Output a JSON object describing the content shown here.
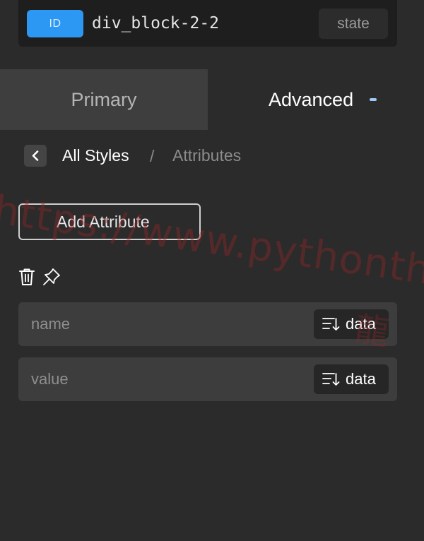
{
  "selector": {
    "badge": "ID",
    "name": "div_block-2-2",
    "state_label": "state"
  },
  "tabs": [
    {
      "label": "Primary",
      "active": false
    },
    {
      "label": "Advanced",
      "active": true
    }
  ],
  "breadcrumb": {
    "current": "All Styles",
    "separator": "/",
    "last": "Attributes"
  },
  "add_attribute_label": "Add Attribute",
  "fields": [
    {
      "placeholder": "name",
      "data_label": "data"
    },
    {
      "placeholder": "value",
      "data_label": "data"
    }
  ],
  "icons": {
    "back": "chevron-left-icon",
    "delete": "trash-icon",
    "pin": "pin-icon",
    "data": "sort-down-icon"
  },
  "watermark": {
    "text": "https://www.pythonthre",
    "cjk": "龍"
  },
  "colors": {
    "background": "#2b2b2b",
    "accent": "#2d98f4",
    "field": "#3d3d3d",
    "tab_inactive": "#3e3e3e"
  }
}
